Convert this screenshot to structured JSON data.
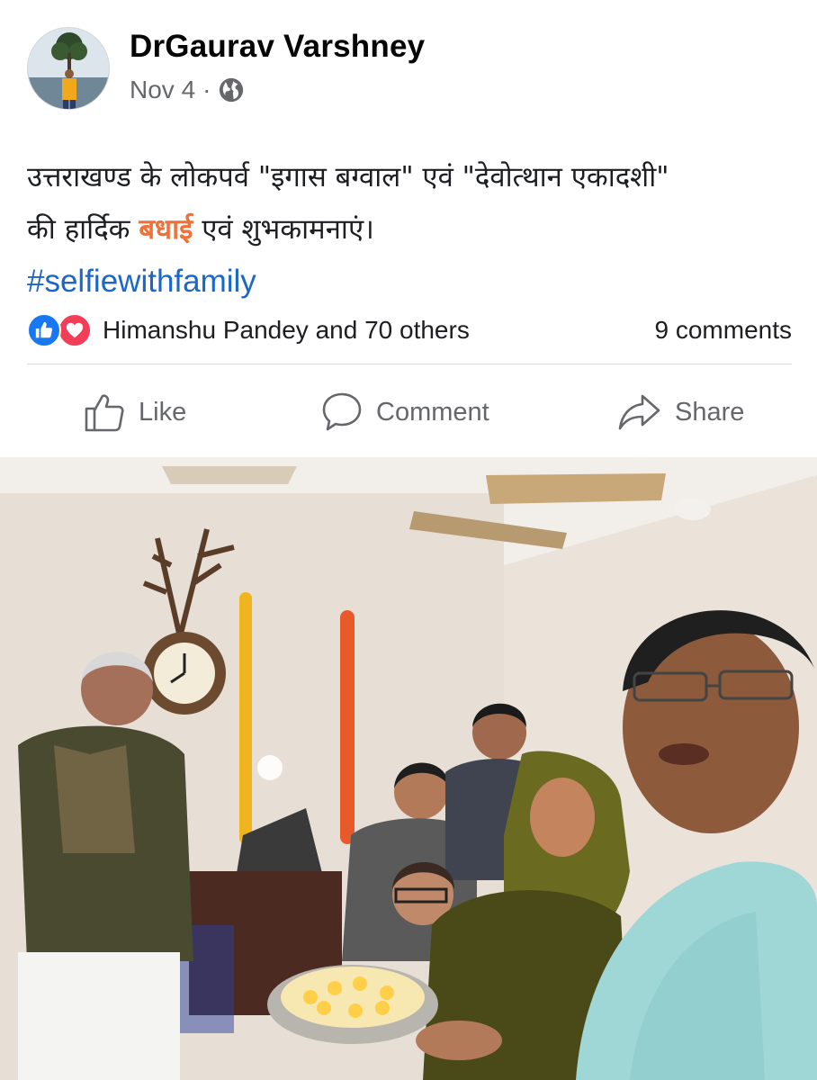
{
  "post": {
    "author": "DrGaurav Varshney",
    "date": "Nov 4",
    "separator": "·",
    "privacy_icon": "globe-icon",
    "text_line1": "उत्तराखण्ड के लोकपर्व  \"इगास बग्वाल\" एवं \"देवोत्थान एकादशी\"",
    "text_line2_a": "की  हार्दिक ",
    "text_line2_highlight": "बधाई",
    "text_line2_b": " एवं शुभकामनाएं।",
    "hashtag": "#selfiewithfamily",
    "highlight_color": "#f0703a",
    "link_color": "#1b66c9"
  },
  "reactions": {
    "icons": [
      "like-icon",
      "love-icon"
    ],
    "summary": "Himanshu Pandey and 70 others",
    "comments": "9 comments"
  },
  "actions": {
    "like": "Like",
    "comment": "Comment",
    "share": "Share"
  }
}
